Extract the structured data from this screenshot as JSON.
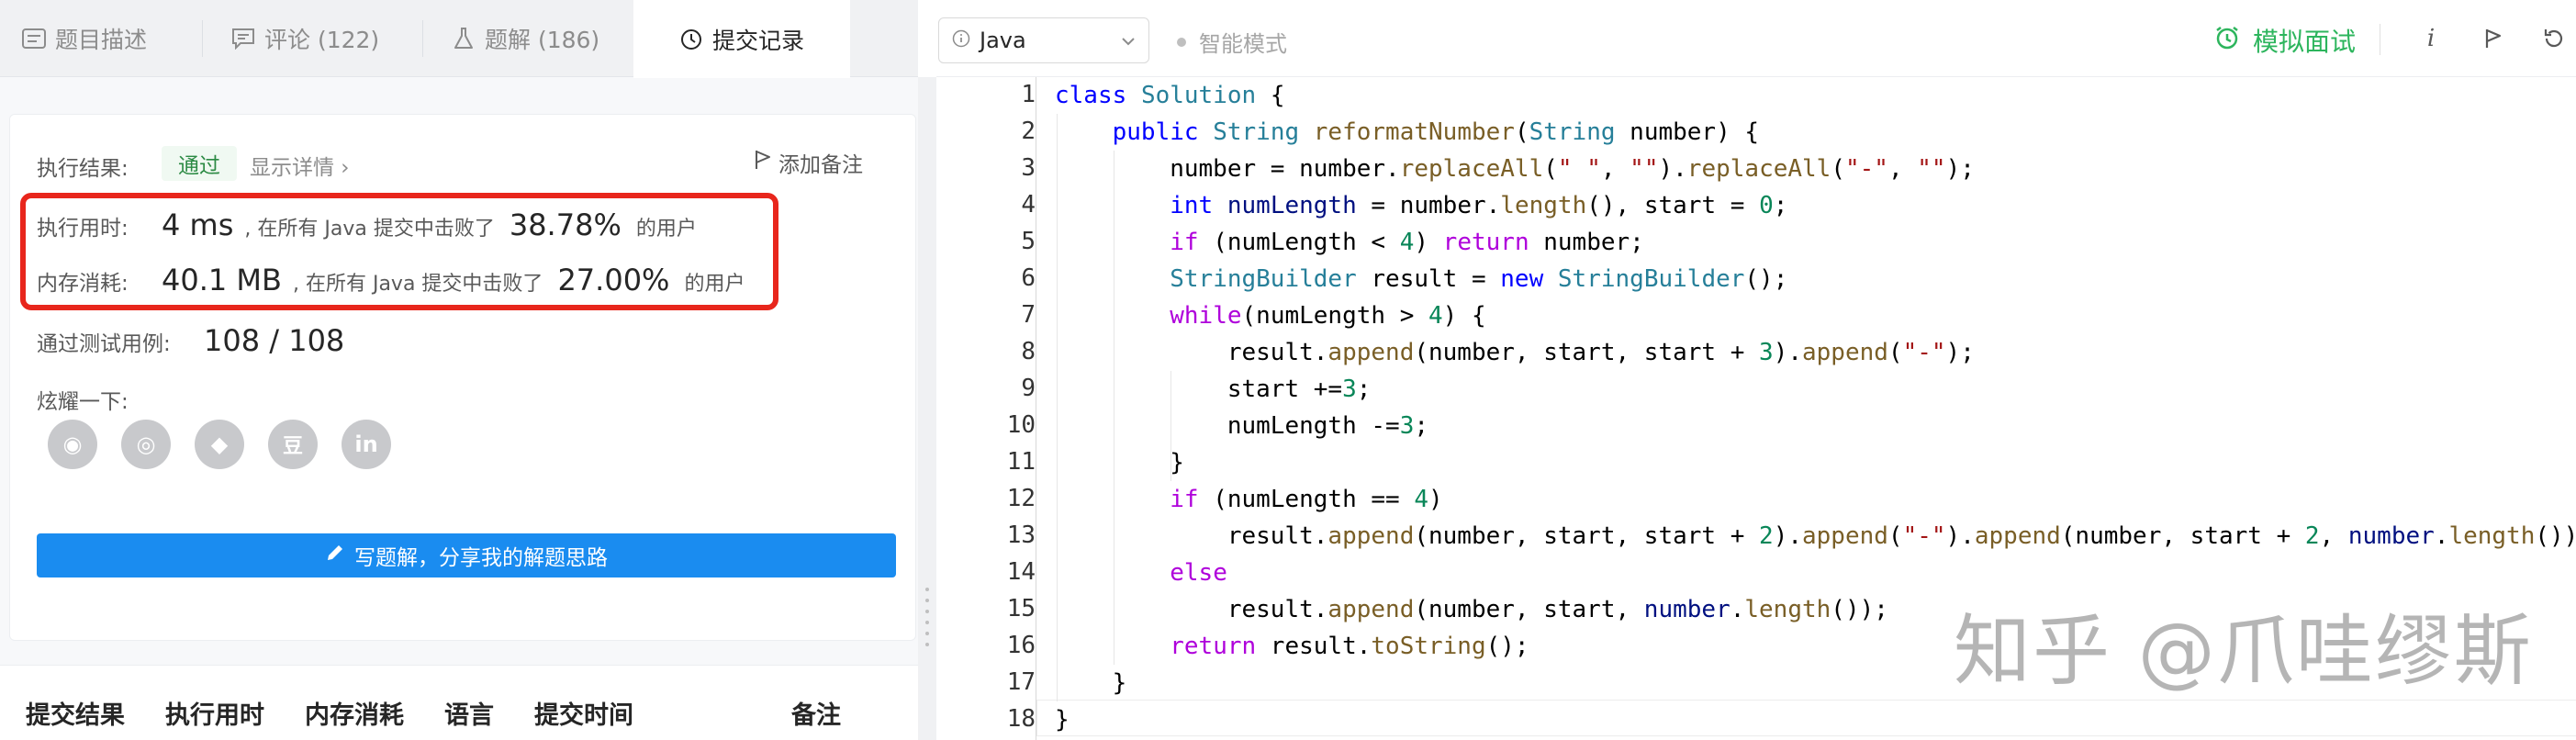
{
  "tabs": [
    {
      "label": "题目描述",
      "icon": "description-icon"
    },
    {
      "label": "评论 (122)",
      "icon": "comment-icon"
    },
    {
      "label": "题解 (186)",
      "icon": "flask-icon"
    },
    {
      "label": "提交记录",
      "icon": "clock-icon",
      "active": true
    }
  ],
  "result": {
    "label": "执行结果:",
    "status": "通过",
    "detail_link": "显示详情 ›",
    "add_note": "添加备注"
  },
  "runtime": {
    "label": "执行用时:",
    "value": "4 ms",
    "mid": ", 在所有 Java 提交中击败了",
    "percent": "38.78%",
    "tail": "的用户"
  },
  "memory": {
    "label": "内存消耗:",
    "value": "40.1 MB",
    "mid": ", 在所有 Java 提交中击败了",
    "percent": "27.00%",
    "tail": "的用户"
  },
  "testcases": {
    "label": "通过测试用例:",
    "value": "108 / 108"
  },
  "share": {
    "label": "炫耀一下:",
    "icons": [
      "wechat-icon",
      "weibo-icon",
      "qq-icon",
      "douban-icon",
      "linkedin-icon"
    ],
    "glyphs": [
      "◉",
      "◎",
      "◆",
      "豆",
      "in"
    ]
  },
  "write_solution": "写题解，分享我的解题思路",
  "submissions_table": {
    "columns": [
      "提交结果",
      "执行用时",
      "内存消耗",
      "语言",
      "提交时间",
      "备注"
    ]
  },
  "toolbar": {
    "language": "Java",
    "smart_mode": "智能模式",
    "mock_interview": "模拟面试",
    "info": "i"
  },
  "code": {
    "line_numbers": [
      "1",
      "2",
      "3",
      "4",
      "5",
      "6",
      "7",
      "8",
      "9",
      "10",
      "11",
      "12",
      "13",
      "14",
      "15",
      "16",
      "17",
      "18"
    ]
  },
  "watermark": "知乎 @爪哇缪斯",
  "colors": {
    "accent_green": "#2db55d",
    "button_blue": "#1a8cf0",
    "highlight_red": "#e8261c"
  }
}
